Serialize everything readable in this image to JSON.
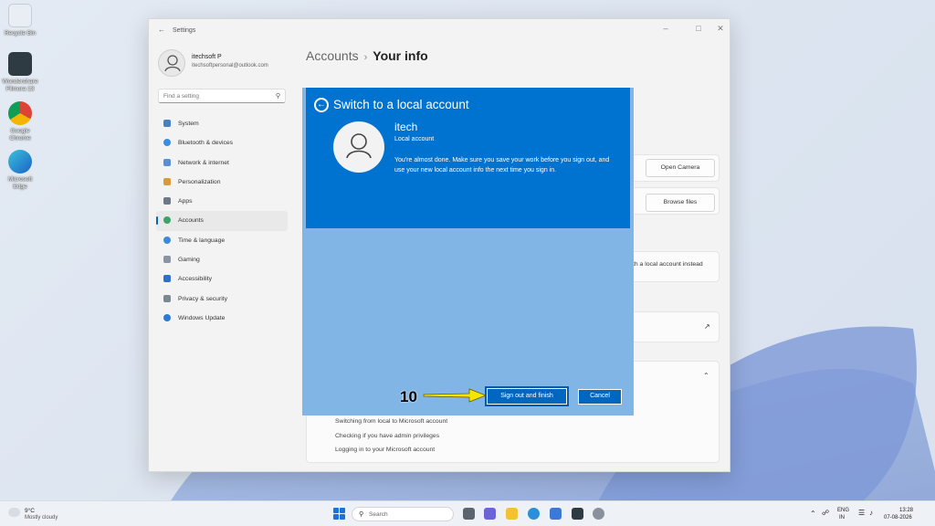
{
  "desktop": {
    "icons": [
      {
        "label": "Recycle Bin"
      },
      {
        "label": "Wondershare Filmora 13"
      },
      {
        "label": "Google Chrome"
      },
      {
        "label": "Microsoft Edge"
      }
    ]
  },
  "settings": {
    "title": "Settings",
    "profile": {
      "name": "itechsoft P",
      "email": "itechsoftpersonal@outlook.com"
    },
    "search_placeholder": "Find a setting",
    "nav": [
      {
        "label": "System"
      },
      {
        "label": "Bluetooth & devices"
      },
      {
        "label": "Network & internet"
      },
      {
        "label": "Personalization"
      },
      {
        "label": "Apps"
      },
      {
        "label": "Accounts"
      },
      {
        "label": "Time & language"
      },
      {
        "label": "Gaming"
      },
      {
        "label": "Accessibility"
      },
      {
        "label": "Privacy & security"
      },
      {
        "label": "Windows Update"
      }
    ],
    "breadcrumb": {
      "parent": "Accounts",
      "current": "Your info"
    },
    "open_camera": "Open Camera",
    "browse_files": "Browse files",
    "local_account_text": "th a local account instead",
    "help_links": [
      "Switching from local to Microsoft account",
      "Checking if you have admin privileges",
      "Logging in to your Microsoft account"
    ]
  },
  "dialog": {
    "title": "Switch to a local account",
    "account_name": "itech",
    "account_type": "Local account",
    "message": "You're almost done. Make sure you save your work before you sign out, and use your new local account info the next time you sign in.",
    "primary_button": "Sign out and finish",
    "cancel_button": "Cancel"
  },
  "annotation": {
    "step": "10"
  },
  "taskbar": {
    "weather_temp": "9°C",
    "weather_desc": "Mostly cloudy",
    "search_placeholder": "Search",
    "lang_top": "ENG",
    "lang_bottom": "IN",
    "time": "13:28",
    "date": "07-08-2026"
  },
  "colors": {
    "dialog_accent": "#0073d0",
    "dialog_body": "#80b5e6",
    "button_primary": "#0067c0",
    "annotation_arrow": "#f5e600"
  }
}
